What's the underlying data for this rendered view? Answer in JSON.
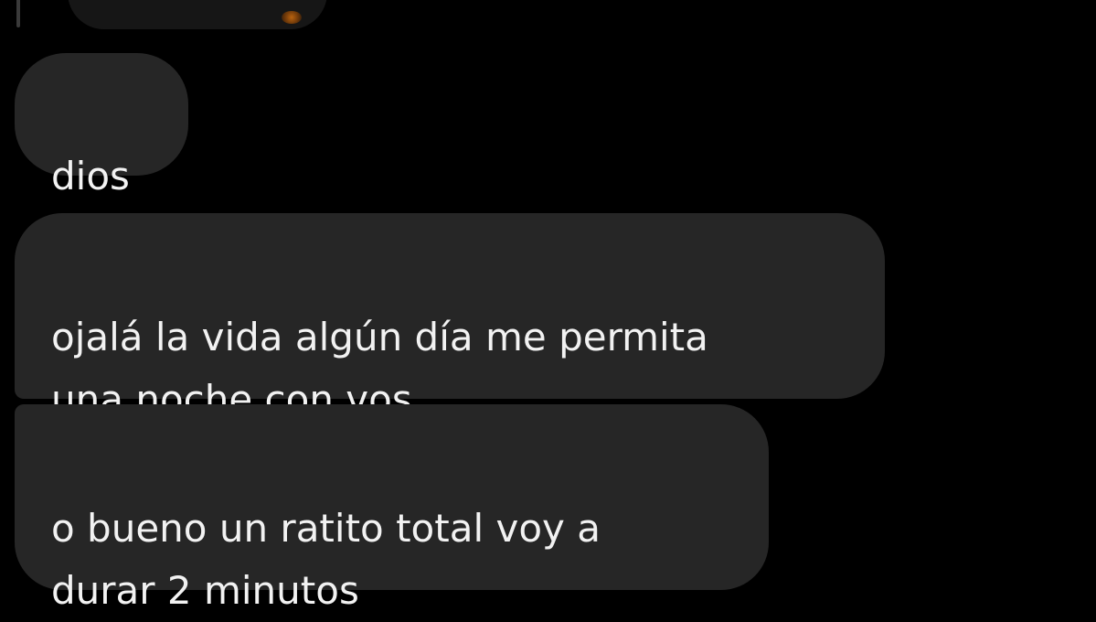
{
  "messages": [
    {
      "text": "dios"
    },
    {
      "text": "ojalá la vida algún día me permita\nuna noche con vos"
    },
    {
      "text": "o bueno un ratito total voy a\ndurar 2 minutos"
    }
  ],
  "colors": {
    "background": "#000000",
    "bubble": "#262626",
    "text": "#f2f2f2"
  }
}
